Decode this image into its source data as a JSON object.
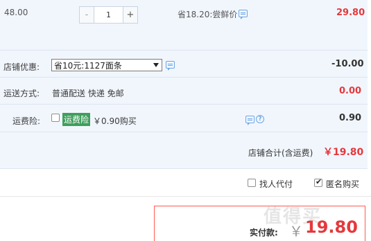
{
  "item": {
    "unit_price": "48.00",
    "quantity": "1",
    "minus_label": "-",
    "plus_label": "+",
    "promo_text": "省18.20:尝鲜价",
    "subtotal": "29.80"
  },
  "shop_discount": {
    "label": "店铺优惠:",
    "selected_option": "省10元:1127面条",
    "amount": "-10.00"
  },
  "shipping": {
    "label": "运送方式:",
    "method": "普通配送 快递 免邮",
    "amount": "0.00"
  },
  "insurance": {
    "label": "运费险:",
    "tag": "运费险",
    "price_text": "￥0.90购买",
    "amount": "0.90",
    "help_icon": "?"
  },
  "shop_total": {
    "label": "店铺合计(含运费)",
    "value": "￥19.80"
  },
  "options": {
    "proxy_pay_label": "找人代付",
    "anonymous_label": "匿名购买",
    "anonymous_checked": true
  },
  "payment": {
    "label": "实付款:",
    "currency": "￥",
    "amount": "19.80"
  },
  "watermark": "值得买",
  "colors": {
    "panel_bg": "#f1f6fd",
    "price_red": "#e4393c",
    "tag_green": "#3f9f5d",
    "icon_blue": "#6aa7e6",
    "pay_border": "#ff5a4e"
  }
}
